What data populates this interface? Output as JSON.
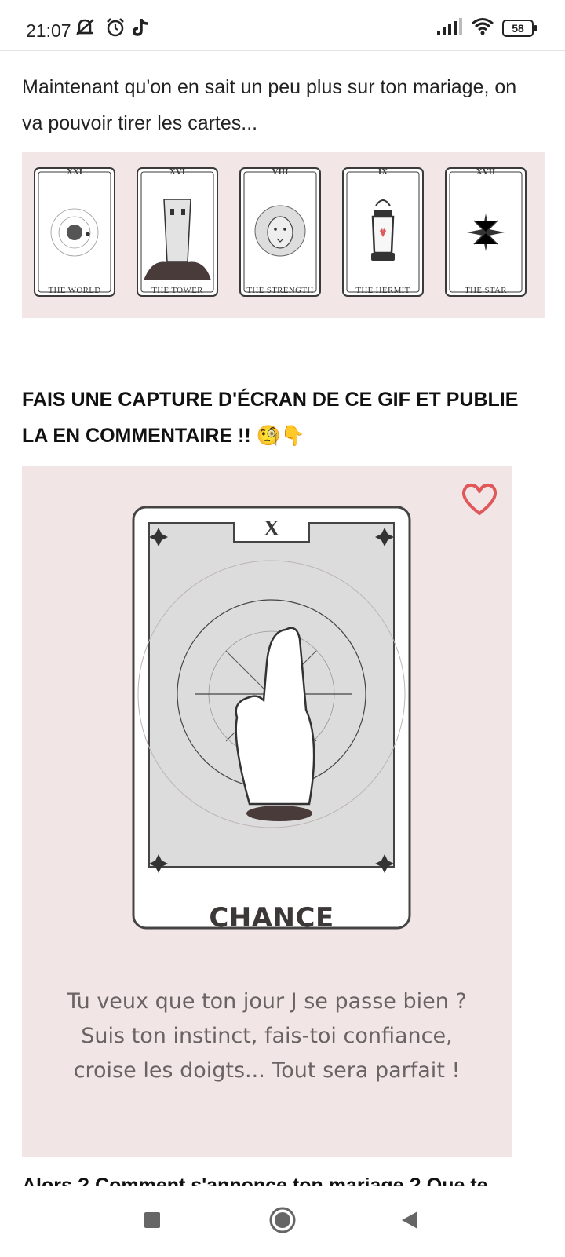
{
  "status_bar": {
    "time": "21:07",
    "battery": "58",
    "icons": [
      "mute-icon",
      "alarm-icon",
      "tiktok-icon",
      "signal-icon",
      "wifi-icon",
      "battery-icon"
    ]
  },
  "post": {
    "intro": "Maintenant qu'on en sait un peu plus sur ton mariage, on va pouvoir tirer les cartes...",
    "cards": [
      {
        "numeral": "XXI",
        "name": "THE WORLD"
      },
      {
        "numeral": "XVI",
        "name": "THE TOWER"
      },
      {
        "numeral": "VIII",
        "name": "THE STRENGTH"
      },
      {
        "numeral": "IX",
        "name": "THE HERMIT"
      },
      {
        "numeral": "XVII",
        "name": "THE STAR"
      }
    ],
    "heading": "FAIS UNE CAPTURE D'ÉCRAN DE CE GIF ET PUBLIE LA EN COMMENTAIRE !!",
    "heading_emoji": "🧐👇",
    "gif": {
      "card_numeral": "X",
      "card_title": "CHANCE",
      "message": "Tu veux que ton jour J se passe bien ? Suis ton instinct, fais-toi confiance, croise les doigts... Tout sera parfait !"
    },
    "cutoff_text": "Alors ? Comment s'annonce ton mariage ? Que te"
  },
  "colors": {
    "card_bg": "#f1e6e5",
    "heart": "#e0585a",
    "ink": "#3c3838"
  }
}
